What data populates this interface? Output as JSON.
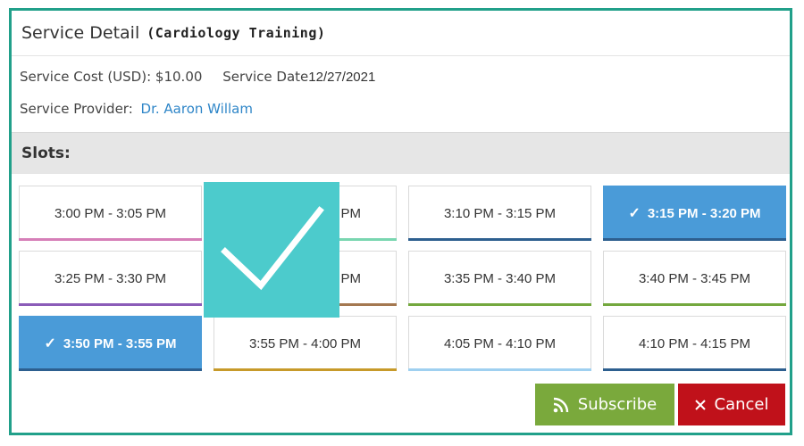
{
  "header": {
    "title": "Service Detail",
    "subtitle": "(Cardiology Training)"
  },
  "details": {
    "cost_label": "Service Cost (USD):",
    "cost_value": "$10.00",
    "date_label": "Service Date",
    "date_value": "12/27/2021",
    "provider_label": "Service Provider:",
    "provider_value": "Dr. Aaron Willam"
  },
  "slots_title": "Slots:",
  "slots": [
    {
      "label": "3:00 PM - 3:05 PM",
      "bar_color": "#d67fb8",
      "selected": false
    },
    {
      "label": "3:05 PM - 3:10 PM",
      "bar_color": "#79d6b0",
      "selected": false
    },
    {
      "label": "3:10 PM - 3:15 PM",
      "bar_color": "#2d5f8f",
      "selected": false
    },
    {
      "label": "3:15 PM - 3:20 PM",
      "bar_color": "#2d5f8f",
      "selected": true
    },
    {
      "label": "3:25 PM - 3:30 PM",
      "bar_color": "#8b5cb8",
      "selected": false
    },
    {
      "label": "3:30 PM - 3:35 PM",
      "bar_color": "#a47850",
      "selected": false
    },
    {
      "label": "3:35 PM - 3:40 PM",
      "bar_color": "#74a83e",
      "selected": false
    },
    {
      "label": "3:40 PM - 3:45 PM",
      "bar_color": "#74a83e",
      "selected": false
    },
    {
      "label": "3:50 PM - 3:55 PM",
      "bar_color": "#2d5f8f",
      "selected": true
    },
    {
      "label": "3:55 PM - 4:00 PM",
      "bar_color": "#c79a2a",
      "selected": false
    },
    {
      "label": "4:05 PM - 4:10 PM",
      "bar_color": "#9fd0f0",
      "selected": false
    },
    {
      "label": "4:10 PM - 4:15 PM",
      "bar_color": "#2d5f8f",
      "selected": false
    }
  ],
  "buttons": {
    "subscribe": "Subscribe",
    "cancel": "Cancel"
  },
  "icons": {
    "overlay": "checkmark-icon",
    "subscribe": "rss-icon",
    "cancel": "close-icon"
  },
  "colors": {
    "border": "#21a08a",
    "selected": "#4a9bd8",
    "subscribe": "#7aa93c",
    "cancel": "#c0111a",
    "overlay": "#4ccbcc"
  }
}
